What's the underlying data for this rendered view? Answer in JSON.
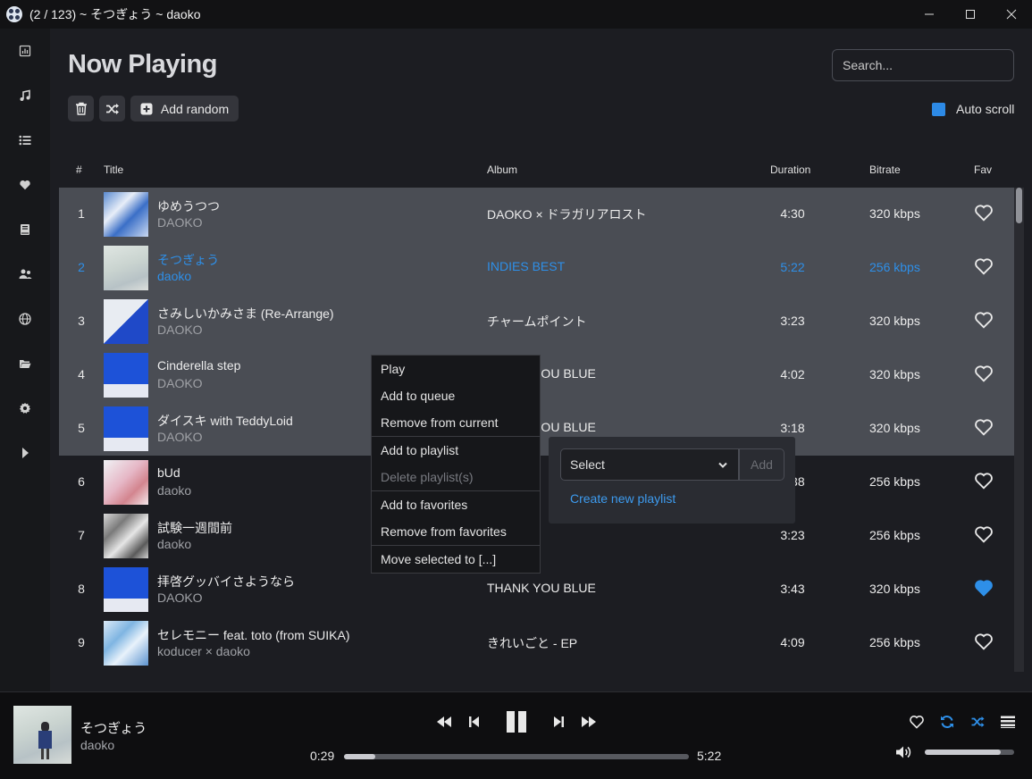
{
  "window": {
    "title": "(2 / 123) ~ そつぎょう ~ daoko",
    "minimize": "—",
    "maximize": "☐",
    "close": "✕"
  },
  "sidebar": {
    "items": [
      {
        "icon": "dashboard-icon"
      },
      {
        "icon": "music-note-icon"
      },
      {
        "icon": "list-icon"
      },
      {
        "icon": "heart-icon"
      },
      {
        "icon": "book-icon"
      },
      {
        "icon": "users-icon"
      },
      {
        "icon": "globe-icon"
      },
      {
        "icon": "folder-icon"
      },
      {
        "icon": "gear-icon"
      },
      {
        "icon": "play-triangle-icon"
      }
    ]
  },
  "header": {
    "title": "Now Playing",
    "search_placeholder": "Search...",
    "add_random_label": "Add random",
    "auto_scroll_label": "Auto scroll",
    "auto_scroll_checked": true
  },
  "table": {
    "columns": {
      "num": "#",
      "title": "Title",
      "album": "Album",
      "duration": "Duration",
      "bitrate": "Bitrate",
      "fav": "Fav"
    },
    "rows": [
      {
        "num": "1",
        "title": "ゆめうつつ",
        "artist": "DAOKO",
        "album": "DAOKO × ドラガリアロスト",
        "duration": "4:30",
        "bitrate": "320 kbps",
        "fav": false
      },
      {
        "num": "2",
        "title": "そつぎょう",
        "artist": "daoko",
        "album": "INDIES BEST",
        "duration": "5:22",
        "bitrate": "256 kbps",
        "fav": false
      },
      {
        "num": "3",
        "title": "さみしいかみさま (Re-Arrange)",
        "artist": "DAOKO",
        "album": "チャームポイント",
        "duration": "3:23",
        "bitrate": "320 kbps",
        "fav": false
      },
      {
        "num": "4",
        "title": "Cinderella step",
        "artist": "DAOKO",
        "album": "THANK YOU BLUE",
        "duration": "4:02",
        "bitrate": "320 kbps",
        "fav": false
      },
      {
        "num": "5",
        "title": "ダイスキ with TeddyLoid",
        "artist": "DAOKO",
        "album": "THANK YOU BLUE",
        "duration": "3:18",
        "bitrate": "320 kbps",
        "fav": false
      },
      {
        "num": "6",
        "title": "bUd",
        "artist": "daoko",
        "album": "",
        "duration": "4:38",
        "bitrate": "256 kbps",
        "fav": false
      },
      {
        "num": "7",
        "title": "試験一週間前",
        "artist": "daoko",
        "album": "",
        "duration": "3:23",
        "bitrate": "256 kbps",
        "fav": false
      },
      {
        "num": "8",
        "title": "拝啓グッバイさようなら",
        "artist": "DAOKO",
        "album": "THANK YOU BLUE",
        "duration": "3:43",
        "bitrate": "320 kbps",
        "fav": true
      },
      {
        "num": "9",
        "title": "セレモニー feat. toto (from SUIKA)",
        "artist": "koducer × daoko",
        "album": "きれいごと - EP",
        "duration": "4:09",
        "bitrate": "256 kbps",
        "fav": false
      }
    ]
  },
  "context_menu": {
    "items": [
      "Play",
      "Add to queue",
      "Remove from current",
      "Add to playlist",
      "Delete playlist(s)",
      "Add to favorites",
      "Remove from favorites",
      "Move selected to [...]"
    ]
  },
  "playlist_submenu": {
    "select_value": "Select",
    "add_label": "Add",
    "create_label": "Create new playlist"
  },
  "player": {
    "title": "そつぎょう",
    "artist": "daoko",
    "elapsed": "0:29",
    "total": "5:22",
    "progress": 0.09,
    "volume": 0.85
  },
  "colors": {
    "accent": "#2e8fe8",
    "selected_row": "#4a4d54",
    "fav_active": "#2e8fe8"
  }
}
